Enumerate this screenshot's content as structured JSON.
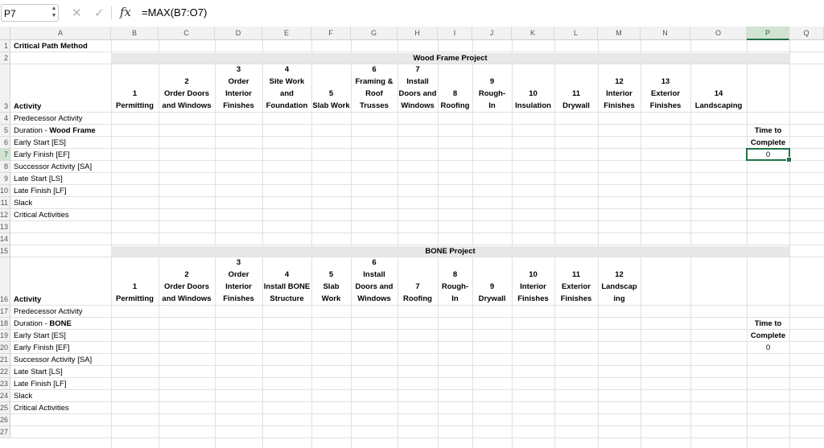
{
  "formula_bar": {
    "name_box": "P7",
    "formula": "=MAX(B7:O7)",
    "fx_label": "fx",
    "cancel_icon": "close-icon",
    "confirm_icon": "check-icon"
  },
  "columns": [
    "A",
    "B",
    "C",
    "D",
    "E",
    "F",
    "G",
    "H",
    "I",
    "J",
    "K",
    "L",
    "M",
    "N",
    "O",
    "P",
    "Q"
  ],
  "selected_column": "P",
  "rows": [
    "1",
    "2",
    "3",
    "4",
    "5",
    "6",
    "7",
    "8",
    "9",
    "10",
    "11",
    "12",
    "13",
    "14",
    "15",
    "16",
    "17",
    "18",
    "19",
    "20",
    "21",
    "22",
    "23",
    "24",
    "25",
    "26",
    "27"
  ],
  "selected_row": "7",
  "colors": {
    "accent": "#217346",
    "band": "#e8e8e8"
  },
  "sheet": {
    "title": "Critical Path Method",
    "wood": {
      "band": "Wood Frame Project",
      "activities": [
        [
          "1",
          "Permitting"
        ],
        [
          "2",
          "Order Doors",
          "and Windows"
        ],
        [
          "3",
          "Order",
          "Interior",
          "Finishes"
        ],
        [
          "4",
          "Site Work",
          "and",
          "Foundation"
        ],
        [
          "5",
          "Slab Work"
        ],
        [
          "6",
          "Framing &",
          "Roof",
          "Trusses"
        ],
        [
          "7",
          "Install",
          "Doors and",
          "Windows"
        ],
        [
          "8",
          "Roofing"
        ],
        [
          "9",
          "Rough-",
          "In"
        ],
        [
          "10",
          "Insulation"
        ],
        [
          "11",
          "Drywall"
        ],
        [
          "12",
          "Interior",
          "Finishes"
        ],
        [
          "13",
          "Exterior",
          "Finishes"
        ],
        [
          "14",
          "Landscaping"
        ]
      ],
      "labels": [
        "Activity",
        "Predecessor Activity",
        "Duration - ",
        "Early Start [ES]",
        "Early Finish [EF]",
        "Successor Activity [SA]",
        "Late Start [LS]",
        "Late Finish [LF]",
        "Slack",
        "Critical Activities"
      ],
      "duration_bold": "Wood Frame",
      "time_to_complete_1": "Time to",
      "time_to_complete_2": "Complete",
      "time_value": "0"
    },
    "bone": {
      "band": "BONE Project",
      "activities": [
        [
          "1",
          "Permitting"
        ],
        [
          "2",
          "Order Doors",
          "and Windows"
        ],
        [
          "3",
          "Order",
          "Interior",
          "Finishes"
        ],
        [
          "4",
          "Install BONE",
          "Structure"
        ],
        [
          "5",
          "Slab",
          "Work"
        ],
        [
          "6",
          "Install",
          "Doors and",
          "Windows"
        ],
        [
          "7",
          "Roofing"
        ],
        [
          "8",
          "Rough-",
          "In"
        ],
        [
          "9",
          "Drywall"
        ],
        [
          "10",
          "Interior",
          "Finishes"
        ],
        [
          "11",
          "Exterior",
          "Finishes"
        ],
        [
          "12",
          "Landscap",
          "ing"
        ]
      ],
      "labels": [
        "Activity",
        "Predecessor Activity",
        "Duration - ",
        "Early Start [ES]",
        "Early Finish [EF]",
        "Successor Activity [SA]",
        "Late Start [LS]",
        "Late Finish [LF]",
        "Slack",
        "Critical Activities"
      ],
      "duration_bold": "BONE",
      "time_to_complete_1": "Time to",
      "time_to_complete_2": "Complete",
      "time_value": "0"
    }
  }
}
